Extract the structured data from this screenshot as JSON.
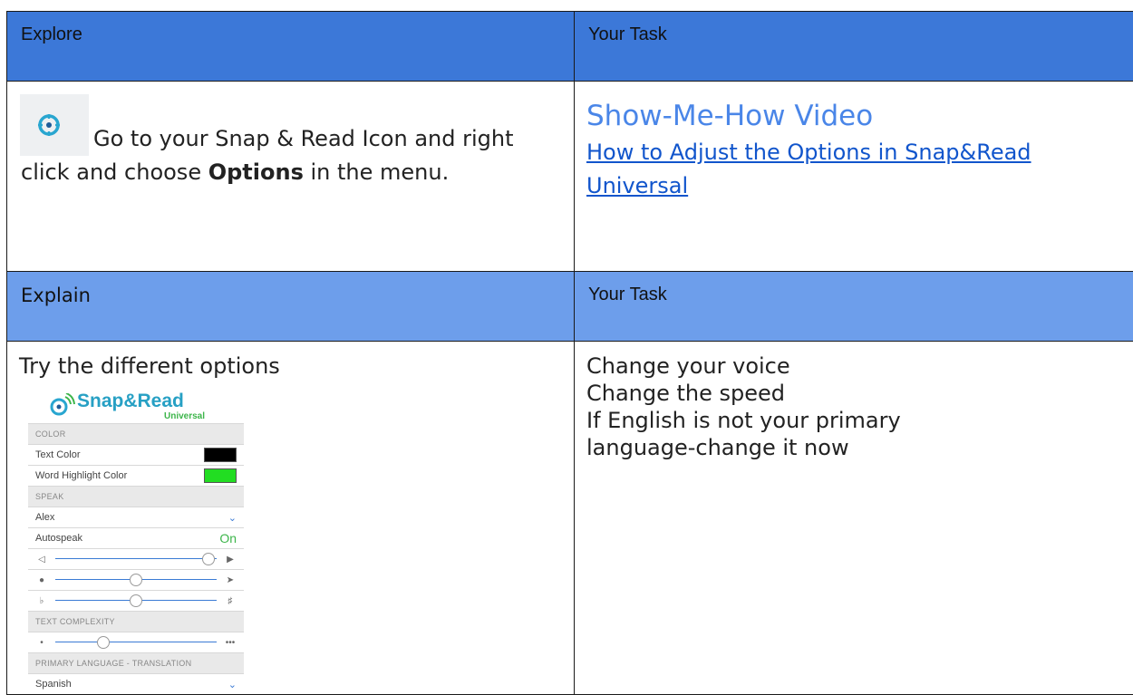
{
  "header1": {
    "left": "Explore",
    "right": "Your Task"
  },
  "explore": {
    "text_pre": "Go to your Snap & Read Icon and right click and choose ",
    "text_bold": "Options",
    "text_post": " in the menu."
  },
  "task1": {
    "video_title": "Show-Me-How Video",
    "video_link": "How to Adjust the Options in Snap&Read Universal"
  },
  "header2": {
    "left": "Explain",
    "right": "Your Task"
  },
  "explain": {
    "text": "Try the different options"
  },
  "task2": {
    "lines": [
      "Change your voice",
      "Change the speed",
      "If English is not your primary",
      "language-change it now"
    ]
  },
  "panel": {
    "logo": "Snap&Read",
    "logo_sub": "Universal",
    "color_section": "COLOR",
    "text_color_label": "Text Color",
    "highlight_label": "Word Highlight Color",
    "speak_section": "SPEAK",
    "voice": "Alex",
    "autospeak_label": "Autospeak",
    "autospeak_value": "On",
    "complexity_section": "TEXT COMPLEXITY",
    "language_section": "PRIMARY LANGUAGE - TRANSLATION",
    "language": "Spanish",
    "sliders": {
      "volume": 0.95,
      "speed": 0.5,
      "pitch": 0.5,
      "complexity": 0.3
    },
    "colors": {
      "text_color": "#000000",
      "highlight_color": "#22dd22"
    }
  },
  "colors": {
    "header_dark": "#3c78d8",
    "header_light": "#6d9eeb",
    "link": "#1155cc",
    "video_title": "#4a86e8"
  }
}
